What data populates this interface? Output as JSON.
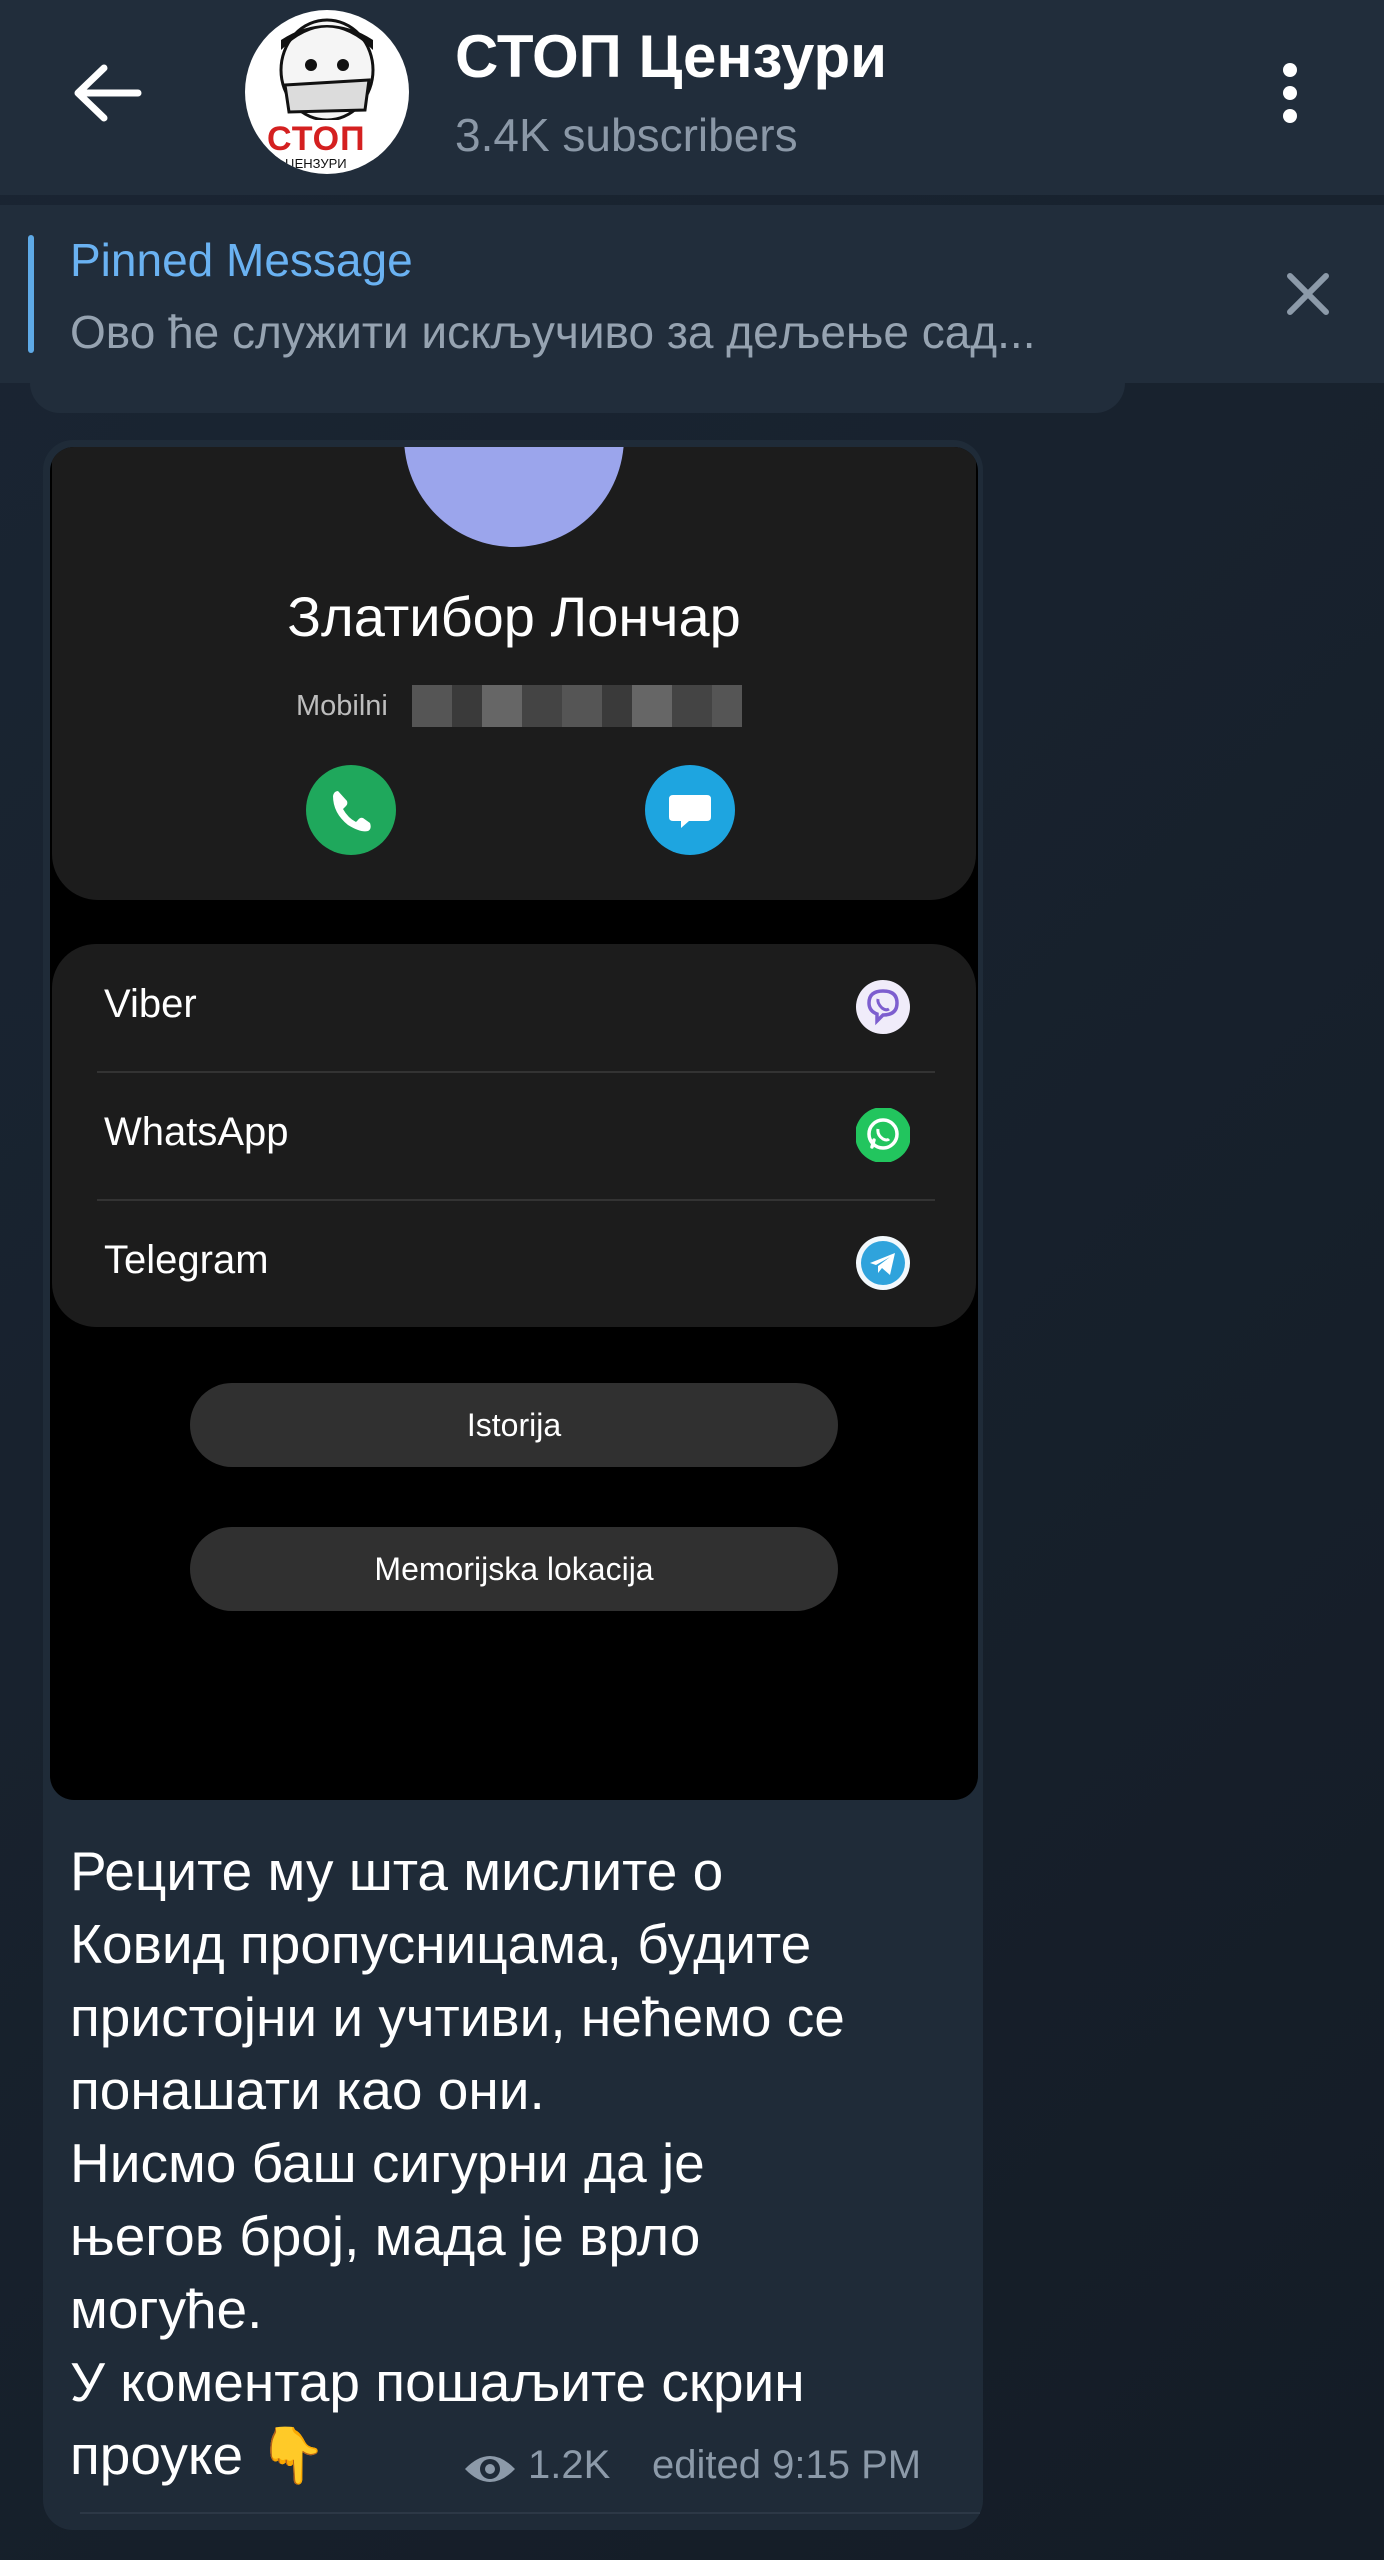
{
  "header": {
    "channel_name": "СТОП Цензури",
    "subscribers": "3.4K subscribers",
    "avatar_text": "СТОП",
    "avatar_subtext": "ЦЕНЗУРИ"
  },
  "pinned": {
    "label": "Pinned Message",
    "text": "Ово ће служити искључиво за дељење сад..."
  },
  "contact_screenshot": {
    "name": "Златибор Лончар",
    "mobile_label": "Mobilni",
    "apps": [
      {
        "label": "Viber",
        "icon": "viber-icon",
        "color": "#7d5ecf"
      },
      {
        "label": "WhatsApp",
        "icon": "whatsapp-icon",
        "color": "#22c55e"
      },
      {
        "label": "Telegram",
        "icon": "telegram-icon",
        "color": "#2fa3dc"
      }
    ],
    "buttons": [
      "Istorija",
      "Memorijska lokacija"
    ]
  },
  "message": {
    "text": "Реците му шта мислите о\nКовид пропусницама, будите\nпристојни и учтиви, нећемо се\nпонашати као они.\nНисмо баш сигурни да је\nњегов број, мада је врло\nмогуће.\nУ коментар пошаљите скрин\nпроуке 👇",
    "views": "1.2K",
    "edited_time": "edited 9:15 PM"
  },
  "colors": {
    "accent": "#6ab2f2",
    "header_bg": "#212d3b",
    "bubble_bg": "#1f2b38"
  }
}
